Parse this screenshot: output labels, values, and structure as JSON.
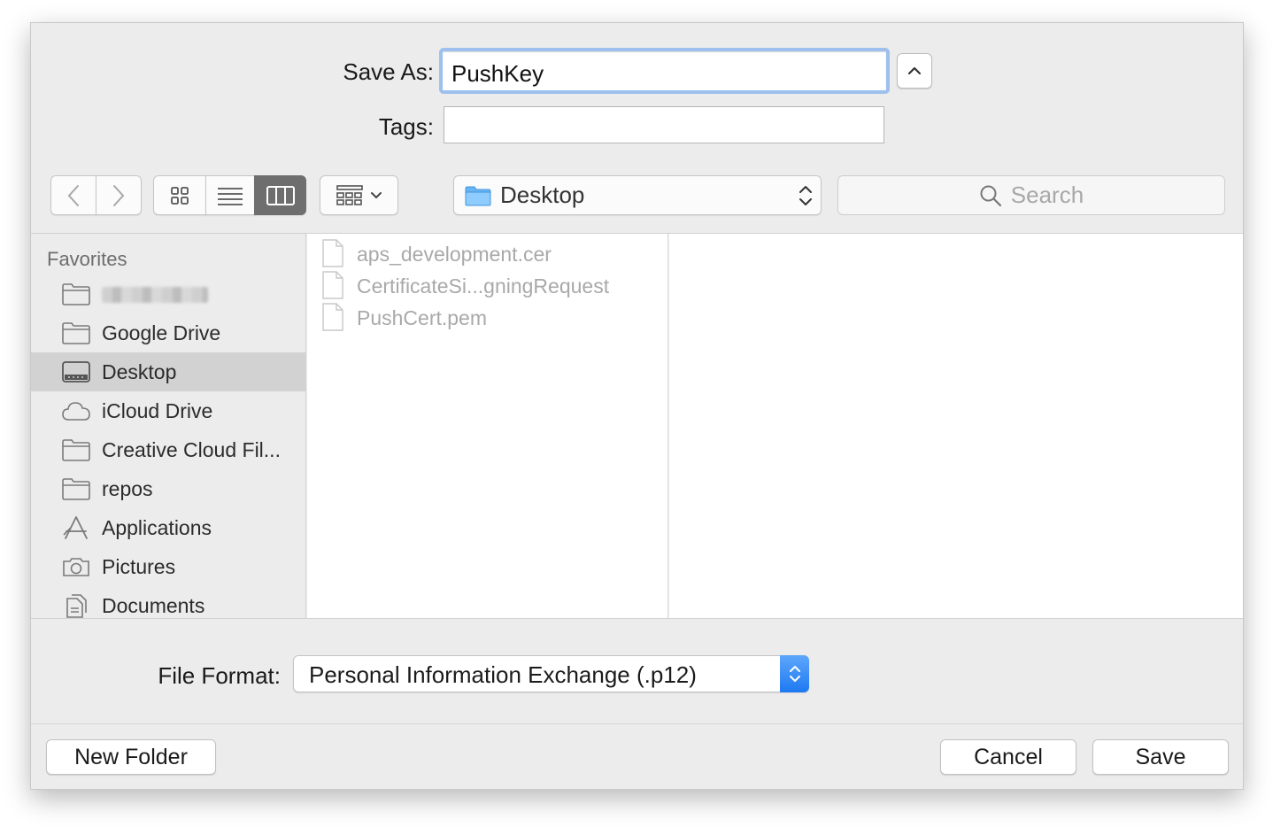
{
  "save_as": {
    "label": "Save As:",
    "value": "PushKey"
  },
  "tags": {
    "label": "Tags:",
    "value": ""
  },
  "toolbar": {
    "location": "Desktop",
    "search_placeholder": "Search"
  },
  "sidebar": {
    "heading": "Favorites",
    "items": [
      {
        "label": "",
        "icon": "folder-icon",
        "blurred": true
      },
      {
        "label": "Google Drive",
        "icon": "folder-icon"
      },
      {
        "label": "Desktop",
        "icon": "desktop-icon",
        "selected": true
      },
      {
        "label": "iCloud Drive",
        "icon": "cloud-icon"
      },
      {
        "label": "Creative Cloud Fil...",
        "icon": "folder-icon"
      },
      {
        "label": "repos",
        "icon": "folder-icon"
      },
      {
        "label": "Applications",
        "icon": "applications-icon"
      },
      {
        "label": "Pictures",
        "icon": "camera-icon"
      },
      {
        "label": "Documents",
        "icon": "documents-icon"
      }
    ]
  },
  "files": [
    {
      "name": "aps_development.cer"
    },
    {
      "name": "CertificateSi...gningRequest"
    },
    {
      "name": "PushCert.pem"
    }
  ],
  "format": {
    "label": "File Format:",
    "value": "Personal Information Exchange (.p12)"
  },
  "buttons": {
    "new_folder": "New Folder",
    "cancel": "Cancel",
    "save": "Save"
  },
  "colors": {
    "focus_ring": "#9dc0ec",
    "stepper_blue": "#1d79f2",
    "selected_row": "#d2d2d2"
  }
}
